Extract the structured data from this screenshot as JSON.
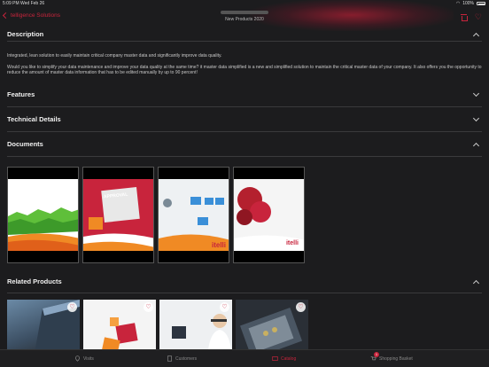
{
  "status_bar": {
    "time_date": "5:09 PM   Wed Feb 26",
    "battery": "100%"
  },
  "nav": {
    "back_label": "telligence Solutions",
    "title": "New Products 2020",
    "accent_color": "#c8243c"
  },
  "sections": {
    "description": {
      "label": "Description",
      "paragraph1": "Integrated, lean solution to easily maintain critical company master data and significantly improve data quality.",
      "paragraph2": "Would you like to simplify your data maintenance and improve your data quality at the same time? it master data simplified is a new and simplified solution to maintain the critical master data of your company. It also offers you the opportunity to reduce the amount of master data information that has to be edited manually by up to 90 percent!"
    },
    "features": {
      "label": "Features"
    },
    "technical": {
      "label": "Technical Details"
    },
    "documents": {
      "label": "Documents",
      "items": [
        {
          "name": "document-1",
          "caption": ""
        },
        {
          "name": "document-2",
          "caption": "APPROVAL"
        },
        {
          "name": "document-3",
          "caption": "itelli"
        },
        {
          "name": "document-4",
          "caption": "itelli"
        }
      ]
    },
    "related": {
      "label": "Related Products"
    }
  },
  "tabbar": {
    "visits": "Visits",
    "customers": "Customers",
    "catalog": "Catalog",
    "basket": "Shopping Basket",
    "basket_count": "1"
  }
}
